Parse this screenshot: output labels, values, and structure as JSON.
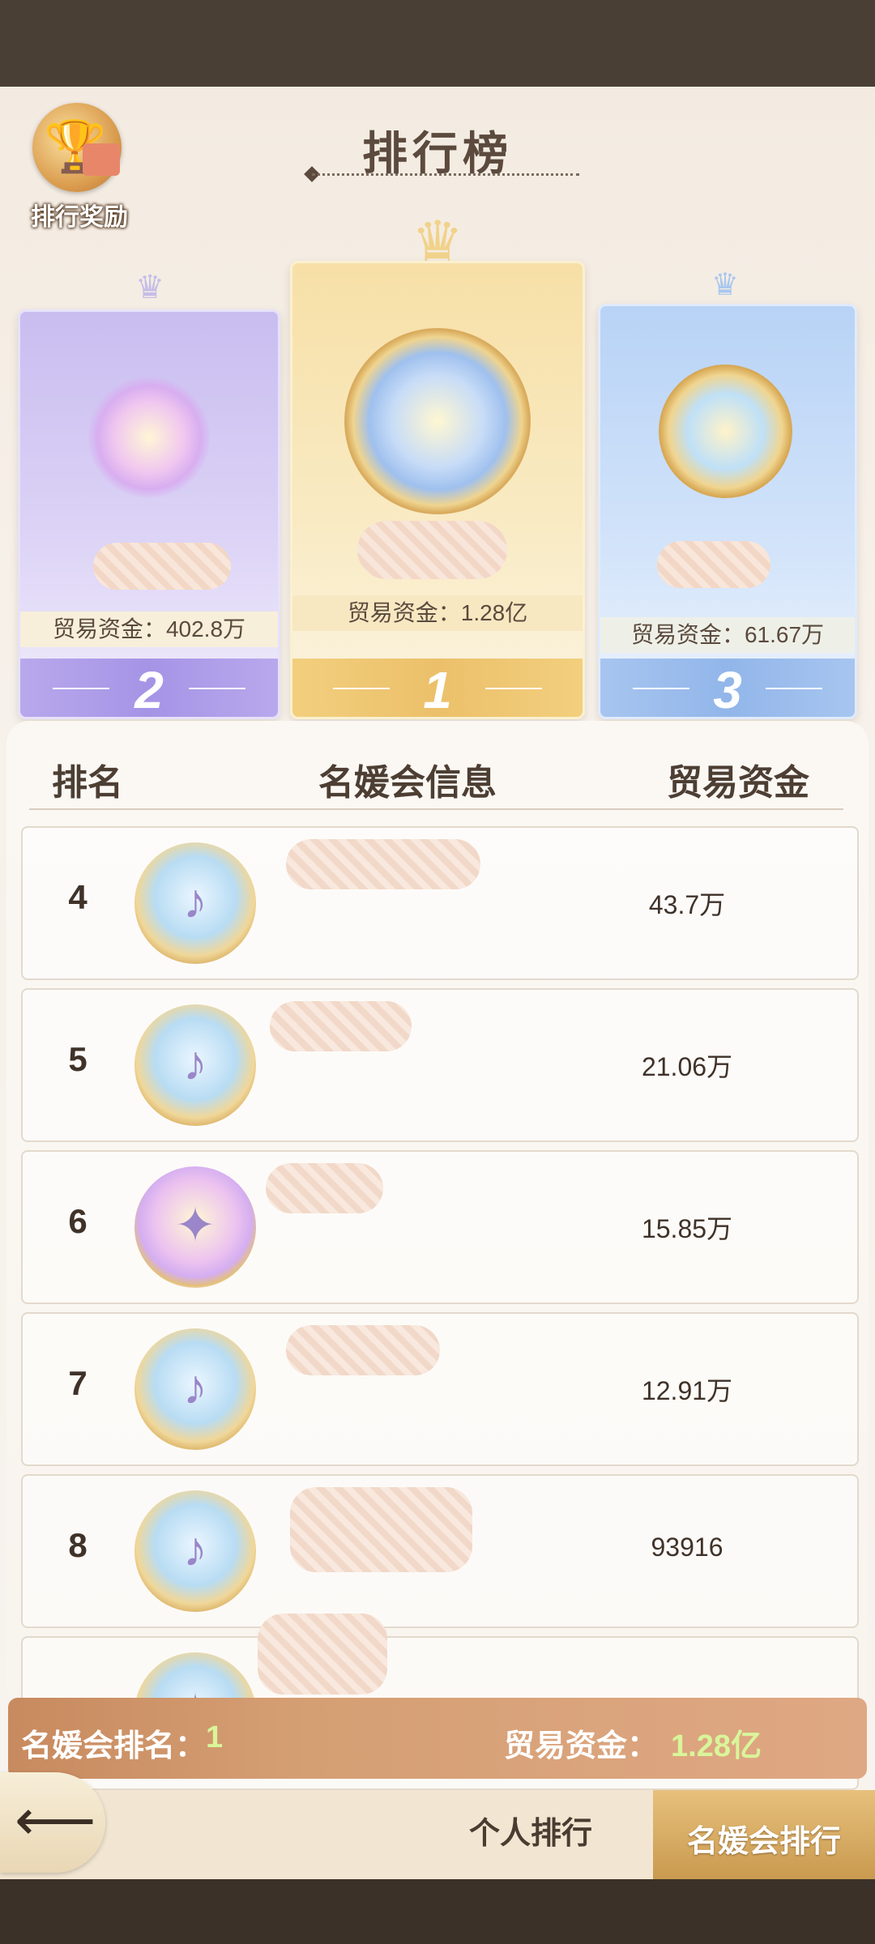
{
  "header": {
    "title": "排行榜",
    "reward_label": "排行奖励"
  },
  "podium": [
    {
      "rank": "2",
      "fund": "贸易资金：402.8万",
      "badge_icon": "winged-diamond-badge-icon"
    },
    {
      "rank": "1",
      "fund": "贸易资金：1.28亿",
      "badge_icon": "winged-diamond-badge-icon"
    },
    {
      "rank": "3",
      "fund": "贸易资金：61.67万",
      "badge_icon": "star-badge-icon"
    }
  ],
  "table": {
    "columns": [
      "排名",
      "名媛会信息",
      "贸易资金"
    ],
    "rows": [
      {
        "rank": "4",
        "fund": "43.7万",
        "badge_icon": "harp-diamond-badge-icon"
      },
      {
        "rank": "5",
        "fund": "21.06万",
        "badge_icon": "harp-badge-icon"
      },
      {
        "rank": "6",
        "fund": "15.85万",
        "badge_icon": "winged-diamond-badge-icon"
      },
      {
        "rank": "7",
        "fund": "12.91万",
        "badge_icon": "harp-badge-icon"
      },
      {
        "rank": "8",
        "fund": "93916",
        "badge_icon": "harp-badge-icon"
      }
    ]
  },
  "summary": {
    "rank_label": "名媛会排名：",
    "rank_value": "1",
    "fund_label": "贸易资金：",
    "fund_value": "1.28亿"
  },
  "nav": {
    "back_icon": "back-arrow-icon",
    "tab_personal": "个人排行",
    "tab_club": "名媛会排行"
  },
  "colors": {
    "accent_gold": "#e7c07c",
    "summary_bar": "#d59f74",
    "summary_value": "#d9f59a",
    "text_dark": "#4d3e33"
  }
}
